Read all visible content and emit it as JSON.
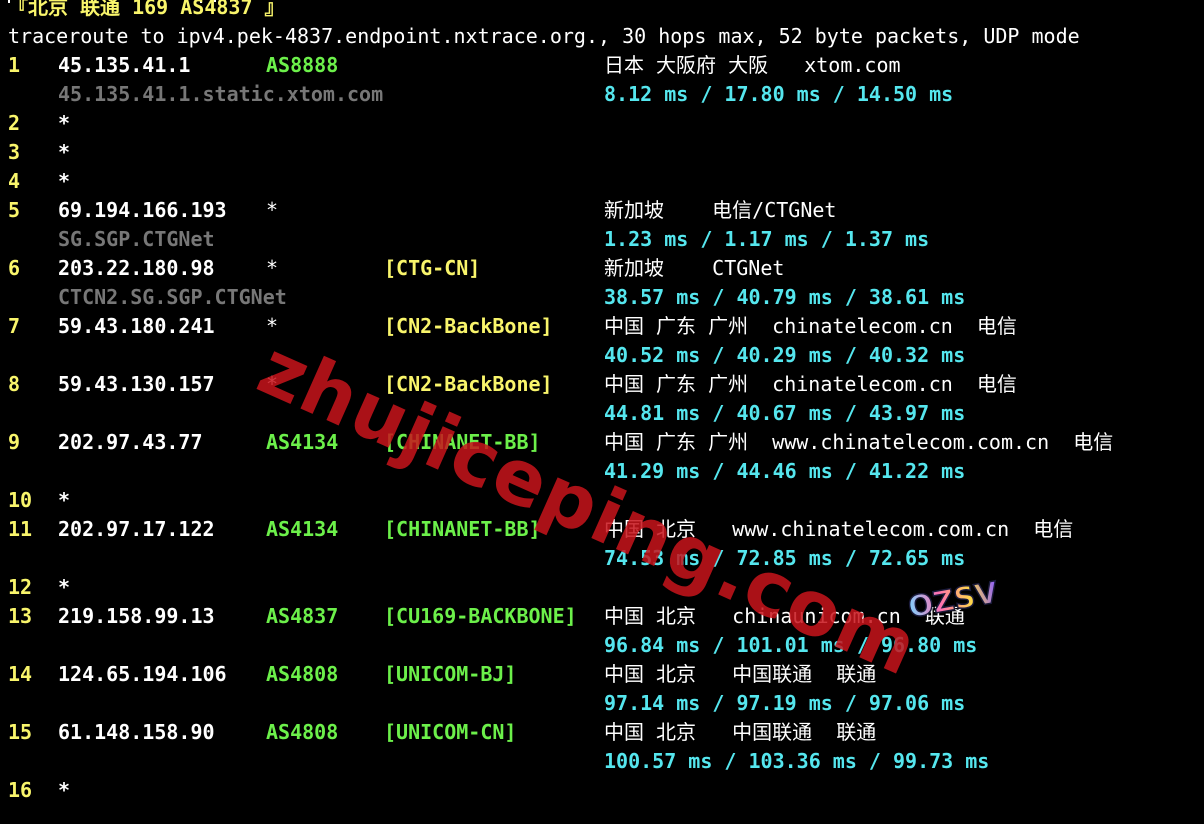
{
  "header": {
    "label": "『北京 联通 169 AS4837 』",
    "command": "traceroute to ipv4.pek-4837.endpoint.nxtrace.org., 30 hops max, 52 byte packets, UDP mode"
  },
  "hops": [
    {
      "hop": "1",
      "ip": "45.135.41.1",
      "asn": "AS8888",
      "asn_color": "green",
      "tag": "",
      "geo": "日本 大阪府 大阪   xtom.com",
      "host": "45.135.41.1.static.xtom.com",
      "rtt": "8.12 ms / 17.80 ms / 14.50 ms"
    },
    {
      "hop": "2",
      "ip": "*"
    },
    {
      "hop": "3",
      "ip": "*"
    },
    {
      "hop": "4",
      "ip": "*"
    },
    {
      "hop": "5",
      "ip": "69.194.166.193",
      "asn": "*",
      "asn_color": "white",
      "tag": "",
      "geo": "新加坡    电信/CTGNet",
      "host": "SG.SGP.CTGNet",
      "rtt": "1.23 ms / 1.17 ms / 1.37 ms"
    },
    {
      "hop": "6",
      "ip": "203.22.180.98",
      "asn": "*",
      "asn_color": "white",
      "tag": "[CTG-CN]",
      "tag_color": "yellow",
      "geo": "新加坡    CTGNet",
      "host": "CTCN2.SG.SGP.CTGNet",
      "rtt": "38.57 ms / 40.79 ms / 38.61 ms"
    },
    {
      "hop": "7",
      "ip": "59.43.180.241",
      "asn": "*",
      "asn_color": "white",
      "tag": "[CN2-BackBone]",
      "tag_color": "yellow",
      "geo": "中国 广东 广州  chinatelecom.cn  电信",
      "host": "",
      "rtt": "40.52 ms / 40.29 ms / 40.32 ms"
    },
    {
      "hop": "8",
      "ip": "59.43.130.157",
      "asn": "*",
      "asn_color": "white",
      "tag": "[CN2-BackBone]",
      "tag_color": "yellow",
      "geo": "中国 广东 广州  chinatelecom.cn  电信",
      "host": "",
      "rtt": "44.81 ms / 40.67 ms / 43.97 ms"
    },
    {
      "hop": "9",
      "ip": "202.97.43.77",
      "asn": "AS4134",
      "asn_color": "green",
      "tag": "[CHINANET-BB]",
      "tag_color": "green",
      "geo": "中国 广东 广州  www.chinatelecom.com.cn  电信",
      "host": "",
      "rtt": "41.29 ms / 44.46 ms / 41.22 ms"
    },
    {
      "hop": "10",
      "ip": "*"
    },
    {
      "hop": "11",
      "ip": "202.97.17.122",
      "asn": "AS4134",
      "asn_color": "green",
      "tag": "[CHINANET-BB]",
      "tag_color": "green",
      "geo": "中国 北京   www.chinatelecom.com.cn  电信",
      "host": "",
      "rtt": "74.53 ms / 72.85 ms / 72.65 ms"
    },
    {
      "hop": "12",
      "ip": "*"
    },
    {
      "hop": "13",
      "ip": "219.158.99.13",
      "asn": "AS4837",
      "asn_color": "green",
      "tag": "[CU169-BACKBONE]",
      "tag_color": "green",
      "geo": "中国 北京   chinaunicom.cn  联通",
      "host": "",
      "rtt": "96.84 ms / 101.01 ms / 96.80 ms"
    },
    {
      "hop": "14",
      "ip": "124.65.194.106",
      "asn": "AS4808",
      "asn_color": "green",
      "tag": "[UNICOM-BJ]",
      "tag_color": "green",
      "geo": "中国 北京   中国联通  联通",
      "host": "",
      "rtt": "97.14 ms / 97.19 ms / 97.06 ms"
    },
    {
      "hop": "15",
      "ip": "61.148.158.90",
      "asn": "AS4808",
      "asn_color": "green",
      "tag": "[UNICOM-CN]",
      "tag_color": "green",
      "geo": "中国 北京   中国联通  联通",
      "host": "",
      "rtt": "100.57 ms / 103.36 ms / 99.73 ms"
    },
    {
      "hop": "16",
      "ip": "*"
    }
  ],
  "watermark": "zhujiceping.com",
  "badge": "OZSV",
  "colors": {
    "background": "#000000",
    "yellow": "#f9f56b",
    "green": "#6cf04a",
    "cyan": "#55e6ee",
    "gray": "#777777",
    "watermark": "#c8141c"
  }
}
